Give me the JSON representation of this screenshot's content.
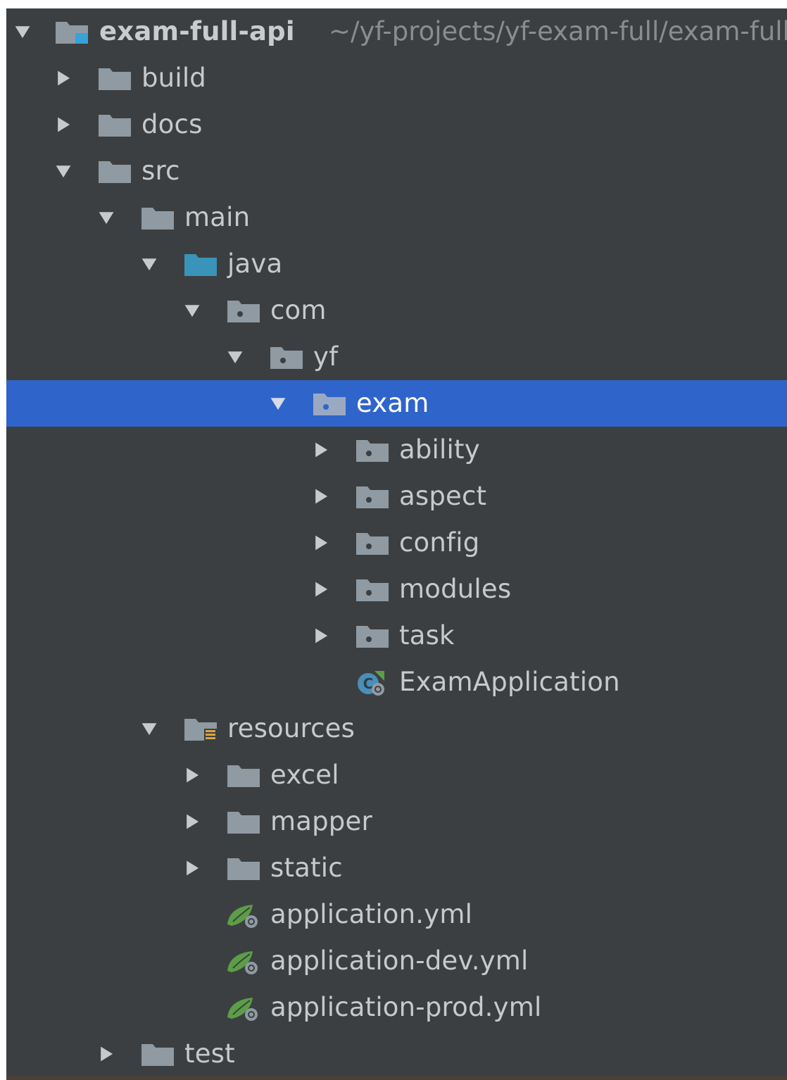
{
  "tree": {
    "root": {
      "label": "exam-full-api",
      "path": "~/yf-projects/yf-exam-full/exam-full-api"
    },
    "rows": [
      {
        "label": "build"
      },
      {
        "label": "docs"
      },
      {
        "label": "src"
      },
      {
        "label": "main"
      },
      {
        "label": "java"
      },
      {
        "label": "com"
      },
      {
        "label": "yf"
      },
      {
        "label": "exam"
      },
      {
        "label": "ability"
      },
      {
        "label": "aspect"
      },
      {
        "label": "config"
      },
      {
        "label": "modules"
      },
      {
        "label": "task"
      },
      {
        "label": "ExamApplication"
      },
      {
        "label": "resources"
      },
      {
        "label": "excel"
      },
      {
        "label": "mapper"
      },
      {
        "label": "static"
      },
      {
        "label": "application.yml"
      },
      {
        "label": "application-dev.yml"
      },
      {
        "label": "application-prod.yml"
      },
      {
        "label": "test"
      }
    ]
  },
  "colors": {
    "panel_bg": "#3c3f41",
    "selection": "#2f65ca",
    "text": "#c7c9cb",
    "folder": "#8f9aa3",
    "source_folder": "#3a93b8",
    "spring_green": "#5b9e47"
  },
  "icons": {
    "module": "module-folder-icon",
    "folder": "folder-icon",
    "source_root": "source-root-folder-icon",
    "package": "package-icon",
    "resources": "resources-root-icon",
    "spring_class": "spring-boot-class-icon",
    "spring_yml": "spring-yml-icon",
    "expanded": "chevron-down-icon",
    "collapsed": "chevron-right-icon"
  }
}
